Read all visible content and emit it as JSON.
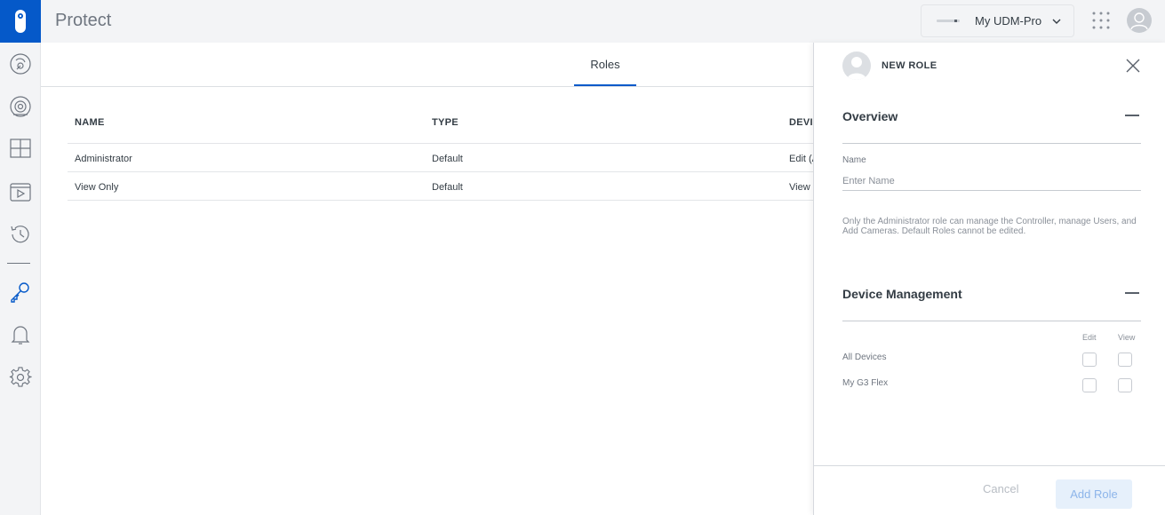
{
  "app": {
    "title": "Protect"
  },
  "sidebar": {
    "items": [
      {
        "name": "live-view",
        "icon": "live-view-icon"
      },
      {
        "name": "cameras",
        "icon": "camera-icon"
      },
      {
        "name": "multiview",
        "icon": "grid-icon"
      },
      {
        "name": "timelapse",
        "icon": "video-icon"
      },
      {
        "name": "history",
        "icon": "history-icon"
      },
      {
        "name": "users",
        "icon": "key-icon",
        "active": true
      },
      {
        "name": "notifications",
        "icon": "bell-icon"
      },
      {
        "name": "settings",
        "icon": "gear-icon"
      }
    ]
  },
  "header": {
    "device_name": "My UDM-Pro"
  },
  "tabs": [
    {
      "label": "Roles",
      "active": true
    }
  ],
  "roles_table": {
    "columns": [
      "NAME",
      "TYPE",
      "DEVI"
    ],
    "rows": [
      {
        "name": "Administrator",
        "type": "Default",
        "devices": "Edit (A"
      },
      {
        "name": "View Only",
        "type": "Default",
        "devices": "View"
      }
    ]
  },
  "panel": {
    "title": "NEW ROLE",
    "overview": {
      "title": "Overview",
      "name_label": "Name",
      "name_placeholder": "Enter Name",
      "name_value": "",
      "help": "Only the Administrator role can manage the Controller, manage Users, and Add Cameras. Default Roles cannot be edited."
    },
    "device_management": {
      "title": "Device Management",
      "col_edit": "Edit",
      "col_view": "View",
      "devices": [
        {
          "label": "All Devices",
          "edit": false,
          "view": false
        },
        {
          "label": "My G3 Flex",
          "edit": false,
          "view": false
        }
      ]
    },
    "footer": {
      "cancel_label": "Cancel",
      "add_label": "Add Role"
    }
  },
  "colors": {
    "accent": "#0559c9",
    "sidebar_bg": "#f3f4f6",
    "disabled_button_bg": "#e6f0fb"
  }
}
